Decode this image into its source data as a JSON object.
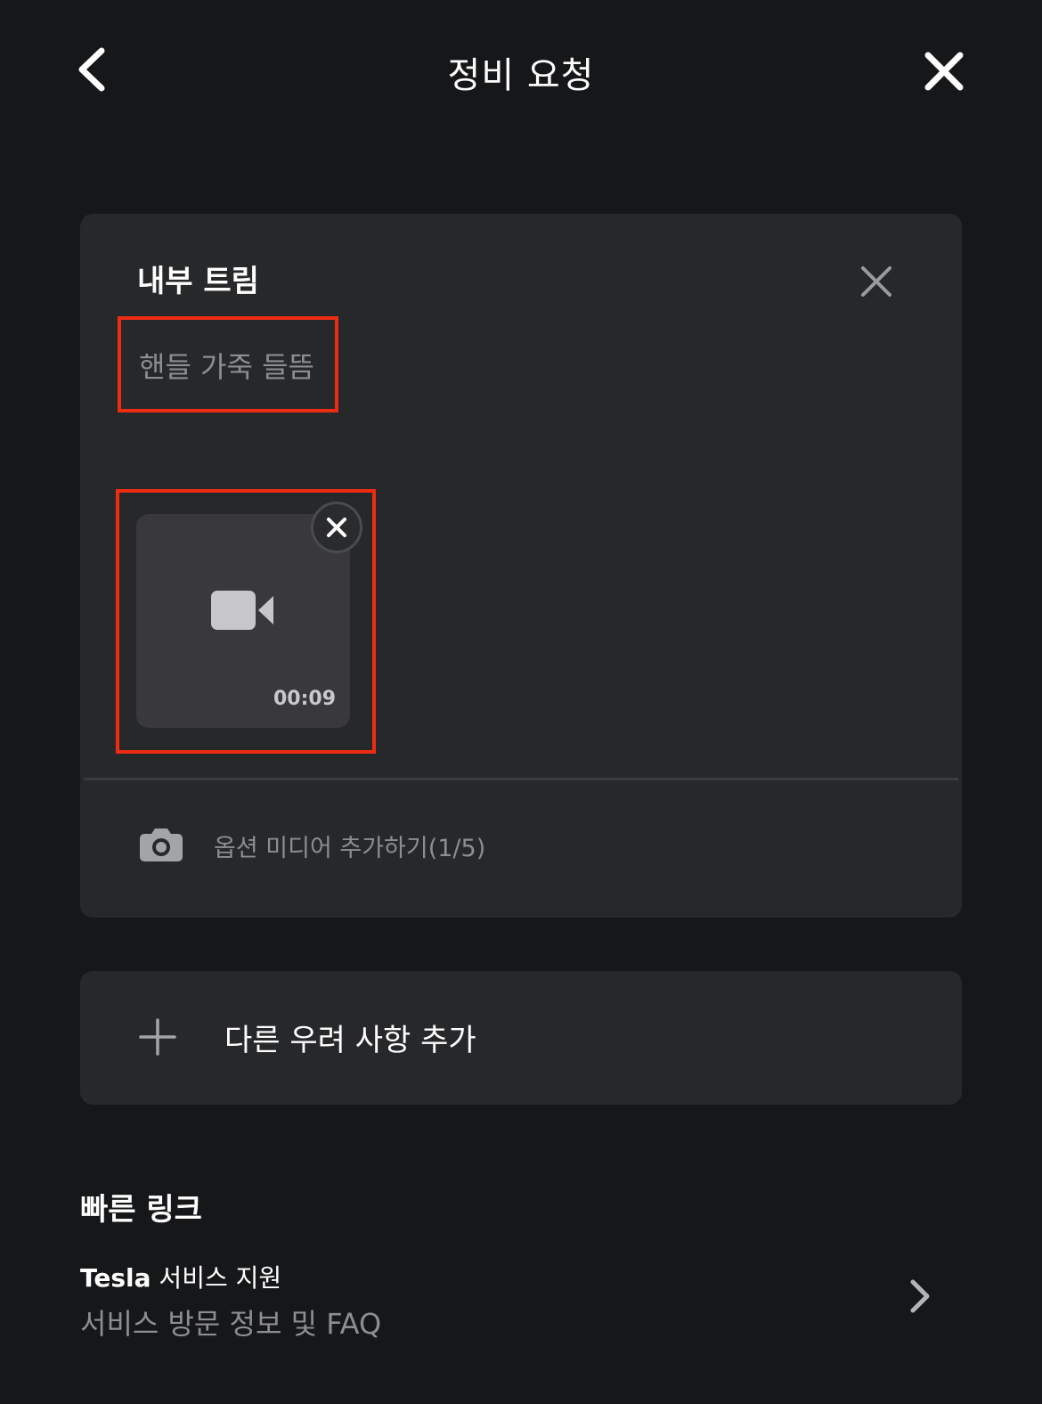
{
  "header": {
    "title": "정비 요청",
    "back_icon": "chevron-left-icon",
    "close_icon": "close-icon"
  },
  "concern": {
    "title": "내부 트림",
    "description": "핸들 가죽 들뜸",
    "remove_icon": "close-icon",
    "media": {
      "type_icon": "video-camera-icon",
      "duration": "00:09",
      "remove_icon": "close-icon"
    },
    "add_media_label": "옵션 미디어 추가하기(1/5)",
    "add_media_icon": "camera-icon"
  },
  "add_concern": {
    "label": "다른 우려 사항 추가",
    "icon": "plus-icon"
  },
  "quick_links": {
    "title": "빠른 링크",
    "items": [
      {
        "brand": "Tesla",
        "title_rest": " 서비스 지원",
        "subtitle": "서비스 방문 정보 및 FAQ",
        "icon": "chevron-right-icon"
      }
    ]
  },
  "colors": {
    "background": "#161719",
    "card": "#27282a",
    "highlight": "#ee2c14",
    "muted_text": "#8d8e90"
  }
}
